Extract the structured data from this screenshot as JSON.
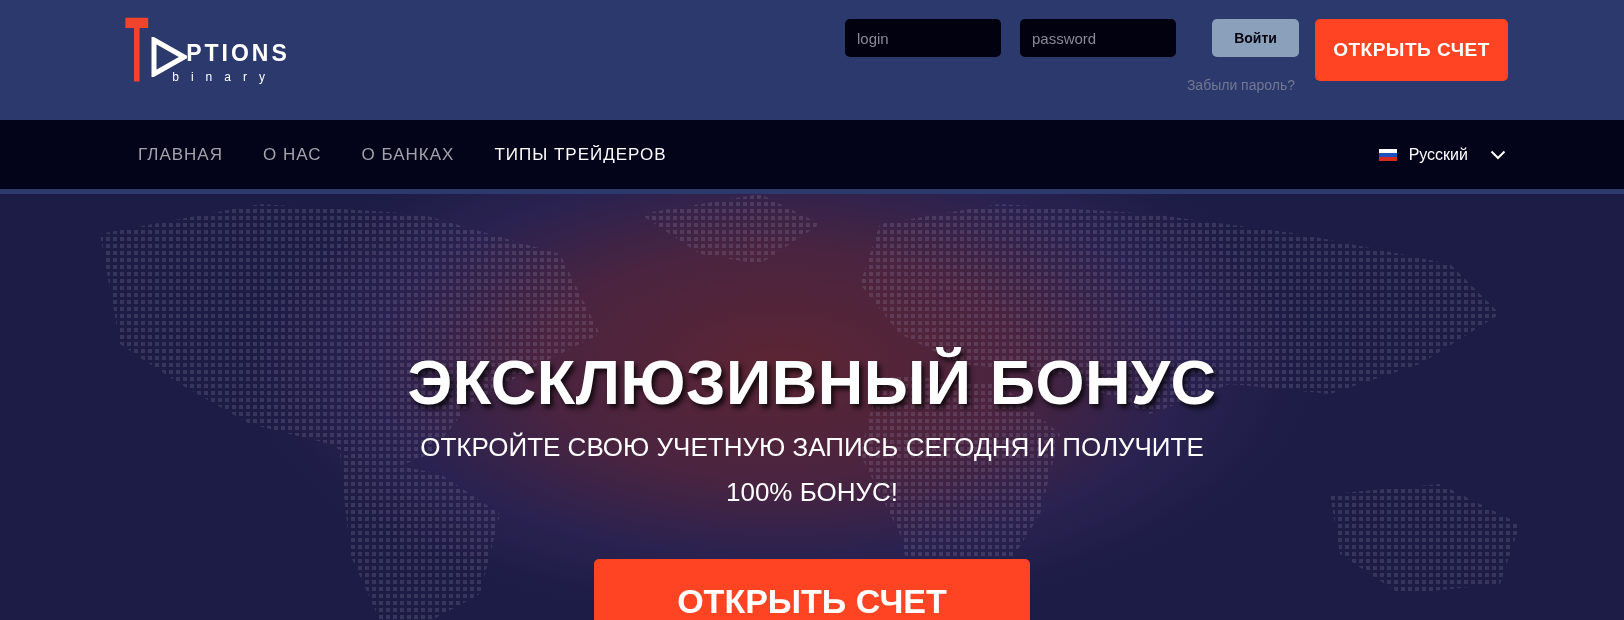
{
  "header": {
    "logo": {
      "mark": "T",
      "name": "PTIONS",
      "tagline": "binary"
    },
    "login_field": {
      "placeholder": "login"
    },
    "password_field": {
      "placeholder": "password"
    },
    "login_button": "Войти",
    "forgot_link": "Забыли пароль?",
    "open_account_button": "ОТКРЫТЬ СЧЕТ"
  },
  "nav": {
    "items": [
      {
        "label": "ГЛАВНАЯ",
        "selected": false
      },
      {
        "label": "О НАС",
        "selected": false
      },
      {
        "label": "О БАНКАХ",
        "selected": false
      },
      {
        "label": "ТИПЫ ТРЕЙДЕРОВ",
        "selected": true
      }
    ],
    "language": {
      "label": "Русский"
    }
  },
  "hero": {
    "title": "ЭКСКЛЮЗИВНЫЙ БОНУС",
    "subtitle": "ОТКРОЙТЕ СВОЮ УЧЕТНУЮ ЗАПИСЬ СЕГОДНЯ И ПОЛУЧИТЕ 100% БОНУС!",
    "cta_button": "ОТКРЫТЬ СЧЕТ"
  }
}
